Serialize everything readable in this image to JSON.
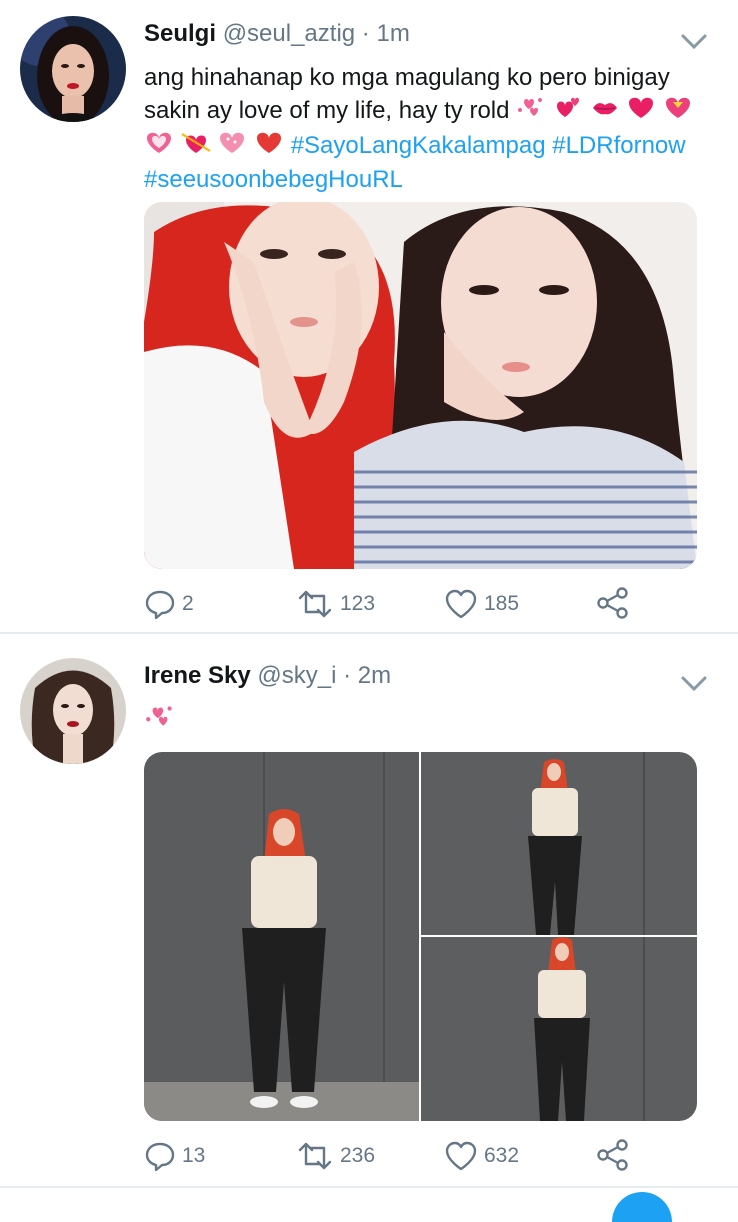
{
  "colors": {
    "accent": "#1da1f2",
    "muted": "#657786",
    "text": "#14171a",
    "divider": "#e6ecf0",
    "heart": "#e0245e"
  },
  "tweets": [
    {
      "name": "Seulgi",
      "handle": "@seul_aztig",
      "dot": "·",
      "time": "1m",
      "text_line1": "ang hinahanap ko mga magulang ko pero binigay",
      "text_line2": "sakin ay love of my life, hay ty rold",
      "hashtags": [
        "#SayoLangKakalampag",
        "#LDRfornow",
        "#seeusoonbebegHouRL"
      ],
      "emojis_line2": [
        "sparkling-hearts-icon",
        "two-hearts-icon",
        "kiss-mark-icon",
        "heart-icon",
        "heart-with-ribbon-icon"
      ],
      "emojis_line3": [
        "heart-with-ribbon-icon",
        "heart-with-arrow-icon",
        "sparkling-heart-icon",
        "red-heart-icon"
      ],
      "replies": "2",
      "retweets": "123",
      "likes": "185",
      "media": "photo-two-friends"
    },
    {
      "name": "Irene Sky",
      "handle": "@sky_i",
      "dot": "·",
      "time": "2m",
      "emoji": "sparkling-hearts-icon",
      "replies": "13",
      "retweets": "236",
      "likes": "632",
      "media": "photo-grid-three"
    }
  ]
}
